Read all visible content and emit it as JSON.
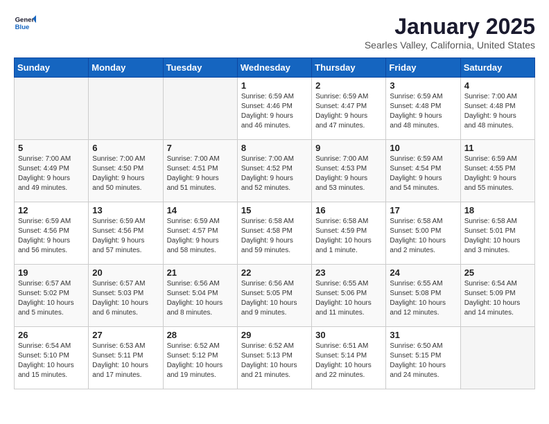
{
  "logo": {
    "line1": "General",
    "line2": "Blue"
  },
  "title": "January 2025",
  "location": "Searles Valley, California, United States",
  "days_header": [
    "Sunday",
    "Monday",
    "Tuesday",
    "Wednesday",
    "Thursday",
    "Friday",
    "Saturday"
  ],
  "weeks": [
    [
      {
        "day": "",
        "info": ""
      },
      {
        "day": "",
        "info": ""
      },
      {
        "day": "",
        "info": ""
      },
      {
        "day": "1",
        "info": "Sunrise: 6:59 AM\nSunset: 4:46 PM\nDaylight: 9 hours\nand 46 minutes."
      },
      {
        "day": "2",
        "info": "Sunrise: 6:59 AM\nSunset: 4:47 PM\nDaylight: 9 hours\nand 47 minutes."
      },
      {
        "day": "3",
        "info": "Sunrise: 6:59 AM\nSunset: 4:48 PM\nDaylight: 9 hours\nand 48 minutes."
      },
      {
        "day": "4",
        "info": "Sunrise: 7:00 AM\nSunset: 4:48 PM\nDaylight: 9 hours\nand 48 minutes."
      }
    ],
    [
      {
        "day": "5",
        "info": "Sunrise: 7:00 AM\nSunset: 4:49 PM\nDaylight: 9 hours\nand 49 minutes."
      },
      {
        "day": "6",
        "info": "Sunrise: 7:00 AM\nSunset: 4:50 PM\nDaylight: 9 hours\nand 50 minutes."
      },
      {
        "day": "7",
        "info": "Sunrise: 7:00 AM\nSunset: 4:51 PM\nDaylight: 9 hours\nand 51 minutes."
      },
      {
        "day": "8",
        "info": "Sunrise: 7:00 AM\nSunset: 4:52 PM\nDaylight: 9 hours\nand 52 minutes."
      },
      {
        "day": "9",
        "info": "Sunrise: 7:00 AM\nSunset: 4:53 PM\nDaylight: 9 hours\nand 53 minutes."
      },
      {
        "day": "10",
        "info": "Sunrise: 6:59 AM\nSunset: 4:54 PM\nDaylight: 9 hours\nand 54 minutes."
      },
      {
        "day": "11",
        "info": "Sunrise: 6:59 AM\nSunset: 4:55 PM\nDaylight: 9 hours\nand 55 minutes."
      }
    ],
    [
      {
        "day": "12",
        "info": "Sunrise: 6:59 AM\nSunset: 4:56 PM\nDaylight: 9 hours\nand 56 minutes."
      },
      {
        "day": "13",
        "info": "Sunrise: 6:59 AM\nSunset: 4:56 PM\nDaylight: 9 hours\nand 57 minutes."
      },
      {
        "day": "14",
        "info": "Sunrise: 6:59 AM\nSunset: 4:57 PM\nDaylight: 9 hours\nand 58 minutes."
      },
      {
        "day": "15",
        "info": "Sunrise: 6:58 AM\nSunset: 4:58 PM\nDaylight: 9 hours\nand 59 minutes."
      },
      {
        "day": "16",
        "info": "Sunrise: 6:58 AM\nSunset: 4:59 PM\nDaylight: 10 hours\nand 1 minute."
      },
      {
        "day": "17",
        "info": "Sunrise: 6:58 AM\nSunset: 5:00 PM\nDaylight: 10 hours\nand 2 minutes."
      },
      {
        "day": "18",
        "info": "Sunrise: 6:58 AM\nSunset: 5:01 PM\nDaylight: 10 hours\nand 3 minutes."
      }
    ],
    [
      {
        "day": "19",
        "info": "Sunrise: 6:57 AM\nSunset: 5:02 PM\nDaylight: 10 hours\nand 5 minutes."
      },
      {
        "day": "20",
        "info": "Sunrise: 6:57 AM\nSunset: 5:03 PM\nDaylight: 10 hours\nand 6 minutes."
      },
      {
        "day": "21",
        "info": "Sunrise: 6:56 AM\nSunset: 5:04 PM\nDaylight: 10 hours\nand 8 minutes."
      },
      {
        "day": "22",
        "info": "Sunrise: 6:56 AM\nSunset: 5:05 PM\nDaylight: 10 hours\nand 9 minutes."
      },
      {
        "day": "23",
        "info": "Sunrise: 6:55 AM\nSunset: 5:06 PM\nDaylight: 10 hours\nand 11 minutes."
      },
      {
        "day": "24",
        "info": "Sunrise: 6:55 AM\nSunset: 5:08 PM\nDaylight: 10 hours\nand 12 minutes."
      },
      {
        "day": "25",
        "info": "Sunrise: 6:54 AM\nSunset: 5:09 PM\nDaylight: 10 hours\nand 14 minutes."
      }
    ],
    [
      {
        "day": "26",
        "info": "Sunrise: 6:54 AM\nSunset: 5:10 PM\nDaylight: 10 hours\nand 15 minutes."
      },
      {
        "day": "27",
        "info": "Sunrise: 6:53 AM\nSunset: 5:11 PM\nDaylight: 10 hours\nand 17 minutes."
      },
      {
        "day": "28",
        "info": "Sunrise: 6:52 AM\nSunset: 5:12 PM\nDaylight: 10 hours\nand 19 minutes."
      },
      {
        "day": "29",
        "info": "Sunrise: 6:52 AM\nSunset: 5:13 PM\nDaylight: 10 hours\nand 21 minutes."
      },
      {
        "day": "30",
        "info": "Sunrise: 6:51 AM\nSunset: 5:14 PM\nDaylight: 10 hours\nand 22 minutes."
      },
      {
        "day": "31",
        "info": "Sunrise: 6:50 AM\nSunset: 5:15 PM\nDaylight: 10 hours\nand 24 minutes."
      },
      {
        "day": "",
        "info": ""
      }
    ]
  ]
}
